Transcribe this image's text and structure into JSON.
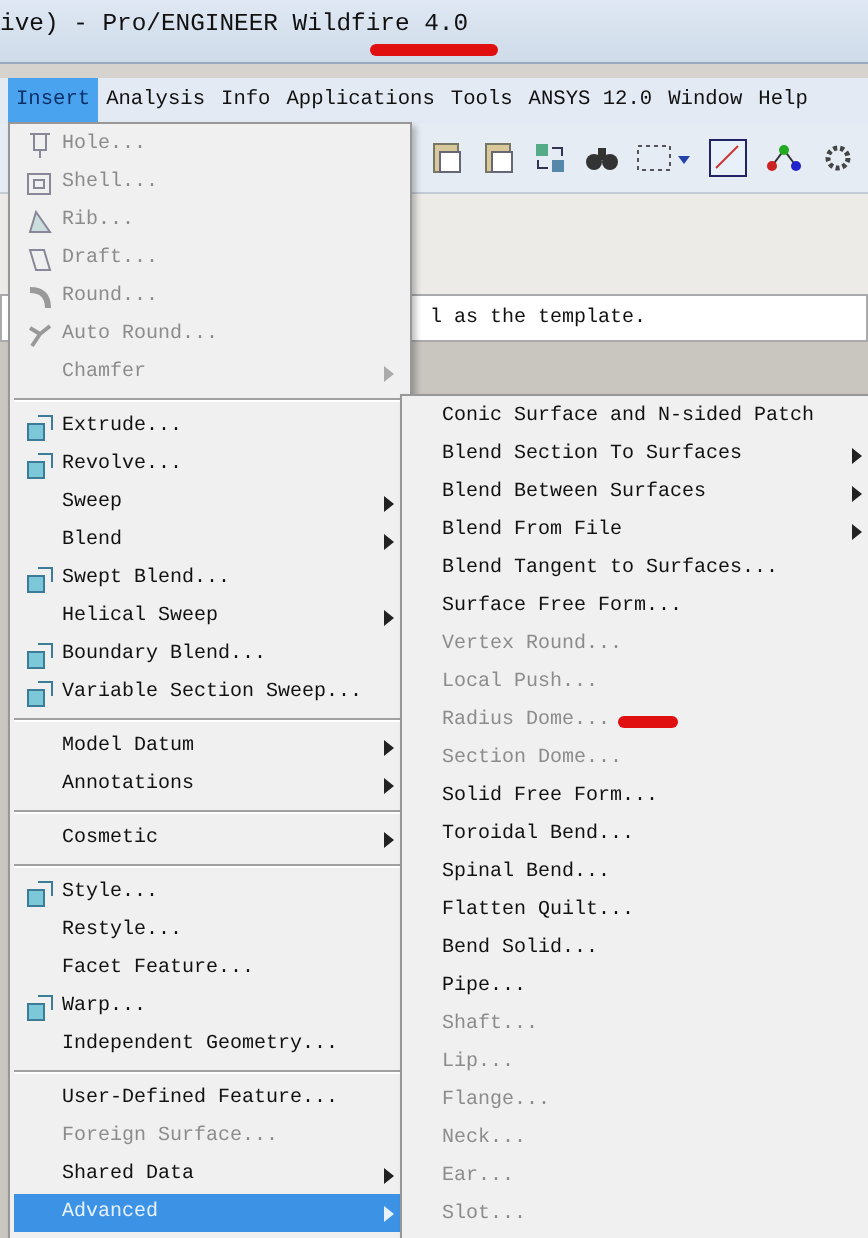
{
  "window": {
    "title": "ive) - Pro/ENGINEER Wildfire 4.0"
  },
  "menu_bar": [
    {
      "label": "Insert",
      "selected": true
    },
    {
      "label": "Analysis",
      "selected": false
    },
    {
      "label": "Info",
      "selected": false
    },
    {
      "label": "Applications",
      "selected": false
    },
    {
      "label": "Tools",
      "selected": false
    },
    {
      "label": "ANSYS 12.0",
      "selected": false
    },
    {
      "label": "Window",
      "selected": false
    },
    {
      "label": "Help",
      "selected": false
    }
  ],
  "message": "l as the template.",
  "insert_menu": [
    {
      "kind": "item",
      "label": "Hole...",
      "has_icon": true,
      "disabled": true,
      "submenu": false,
      "selected": false
    },
    {
      "kind": "item",
      "label": "Shell...",
      "has_icon": true,
      "disabled": true,
      "submenu": false,
      "selected": false
    },
    {
      "kind": "item",
      "label": "Rib...",
      "has_icon": true,
      "disabled": true,
      "submenu": false,
      "selected": false
    },
    {
      "kind": "item",
      "label": "Draft...",
      "has_icon": true,
      "disabled": true,
      "submenu": false,
      "selected": false
    },
    {
      "kind": "item",
      "label": "Round...",
      "has_icon": true,
      "disabled": true,
      "submenu": false,
      "selected": false
    },
    {
      "kind": "item",
      "label": "Auto Round...",
      "has_icon": true,
      "disabled": true,
      "submenu": false,
      "selected": false
    },
    {
      "kind": "item",
      "label": "Chamfer",
      "has_icon": false,
      "disabled": true,
      "submenu": true,
      "selected": false
    },
    {
      "kind": "separator"
    },
    {
      "kind": "item",
      "label": "Extrude...",
      "has_icon": true,
      "disabled": false,
      "submenu": false,
      "selected": false
    },
    {
      "kind": "item",
      "label": "Revolve...",
      "has_icon": true,
      "disabled": false,
      "submenu": false,
      "selected": false
    },
    {
      "kind": "item",
      "label": "Sweep",
      "has_icon": false,
      "disabled": false,
      "submenu": true,
      "selected": false
    },
    {
      "kind": "item",
      "label": "Blend",
      "has_icon": false,
      "disabled": false,
      "submenu": true,
      "selected": false
    },
    {
      "kind": "item",
      "label": "Swept Blend...",
      "has_icon": true,
      "disabled": false,
      "submenu": false,
      "selected": false
    },
    {
      "kind": "item",
      "label": "Helical Sweep",
      "has_icon": false,
      "disabled": false,
      "submenu": true,
      "selected": false
    },
    {
      "kind": "item",
      "label": "Boundary Blend...",
      "has_icon": true,
      "disabled": false,
      "submenu": false,
      "selected": false
    },
    {
      "kind": "item",
      "label": "Variable Section Sweep...",
      "has_icon": true,
      "disabled": false,
      "submenu": false,
      "selected": false
    },
    {
      "kind": "separator"
    },
    {
      "kind": "item",
      "label": "Model Datum",
      "has_icon": false,
      "disabled": false,
      "submenu": true,
      "selected": false
    },
    {
      "kind": "item",
      "label": "Annotations",
      "has_icon": false,
      "disabled": false,
      "submenu": true,
      "selected": false
    },
    {
      "kind": "separator"
    },
    {
      "kind": "item",
      "label": "Cosmetic",
      "has_icon": false,
      "disabled": false,
      "submenu": true,
      "selected": false
    },
    {
      "kind": "separator"
    },
    {
      "kind": "item",
      "label": "Style...",
      "has_icon": true,
      "disabled": false,
      "submenu": false,
      "selected": false
    },
    {
      "kind": "item",
      "label": "Restyle...",
      "has_icon": false,
      "disabled": false,
      "submenu": false,
      "selected": false
    },
    {
      "kind": "item",
      "label": "Facet Feature...",
      "has_icon": false,
      "disabled": false,
      "submenu": false,
      "selected": false
    },
    {
      "kind": "item",
      "label": "Warp...",
      "has_icon": true,
      "disabled": false,
      "submenu": false,
      "selected": false
    },
    {
      "kind": "item",
      "label": "Independent Geometry...",
      "has_icon": false,
      "disabled": false,
      "submenu": false,
      "selected": false
    },
    {
      "kind": "separator"
    },
    {
      "kind": "item",
      "label": "User-Defined Feature...",
      "has_icon": false,
      "disabled": false,
      "submenu": false,
      "selected": false
    },
    {
      "kind": "item",
      "label": "Foreign Surface...",
      "has_icon": false,
      "disabled": true,
      "submenu": false,
      "selected": false
    },
    {
      "kind": "item",
      "label": "Shared Data",
      "has_icon": false,
      "disabled": false,
      "submenu": true,
      "selected": false
    },
    {
      "kind": "item",
      "label": "Advanced",
      "has_icon": false,
      "disabled": false,
      "submenu": true,
      "selected": true
    }
  ],
  "advanced_submenu": [
    {
      "kind": "item",
      "label": "Conic Surface and N-sided Patch",
      "disabled": false,
      "submenu": false
    },
    {
      "kind": "item",
      "label": "Blend Section To Surfaces",
      "disabled": false,
      "submenu": true
    },
    {
      "kind": "item",
      "label": "Blend Between Surfaces",
      "disabled": false,
      "submenu": true
    },
    {
      "kind": "item",
      "label": "Blend From File",
      "disabled": false,
      "submenu": true
    },
    {
      "kind": "item",
      "label": "Blend Tangent to Surfaces...",
      "disabled": false,
      "submenu": false
    },
    {
      "kind": "item",
      "label": "Surface Free Form...",
      "disabled": false,
      "submenu": false
    },
    {
      "kind": "item",
      "label": "Vertex Round...",
      "disabled": true,
      "submenu": false
    },
    {
      "kind": "item",
      "label": "Local Push...",
      "disabled": true,
      "submenu": false
    },
    {
      "kind": "item",
      "label": "Radius Dome...",
      "disabled": true,
      "submenu": false
    },
    {
      "kind": "item",
      "label": "Section Dome...",
      "disabled": true,
      "submenu": false
    },
    {
      "kind": "item",
      "label": "Solid Free Form...",
      "disabled": false,
      "submenu": false
    },
    {
      "kind": "item",
      "label": "Toroidal Bend...",
      "disabled": false,
      "submenu": false
    },
    {
      "kind": "item",
      "label": "Spinal Bend...",
      "disabled": false,
      "submenu": false
    },
    {
      "kind": "item",
      "label": "Flatten Quilt...",
      "disabled": false,
      "submenu": false
    },
    {
      "kind": "item",
      "label": "Bend Solid...",
      "disabled": false,
      "submenu": false
    },
    {
      "kind": "item",
      "label": "Pipe...",
      "disabled": false,
      "submenu": false
    },
    {
      "kind": "item",
      "label": "Shaft...",
      "disabled": true,
      "submenu": false
    },
    {
      "kind": "item",
      "label": "Lip...",
      "disabled": true,
      "submenu": false
    },
    {
      "kind": "item",
      "label": "Flange...",
      "disabled": true,
      "submenu": false
    },
    {
      "kind": "item",
      "label": "Neck...",
      "disabled": true,
      "submenu": false
    },
    {
      "kind": "item",
      "label": "Ear...",
      "disabled": true,
      "submenu": false
    },
    {
      "kind": "item",
      "label": "Slot...",
      "disabled": true,
      "submenu": false
    }
  ]
}
